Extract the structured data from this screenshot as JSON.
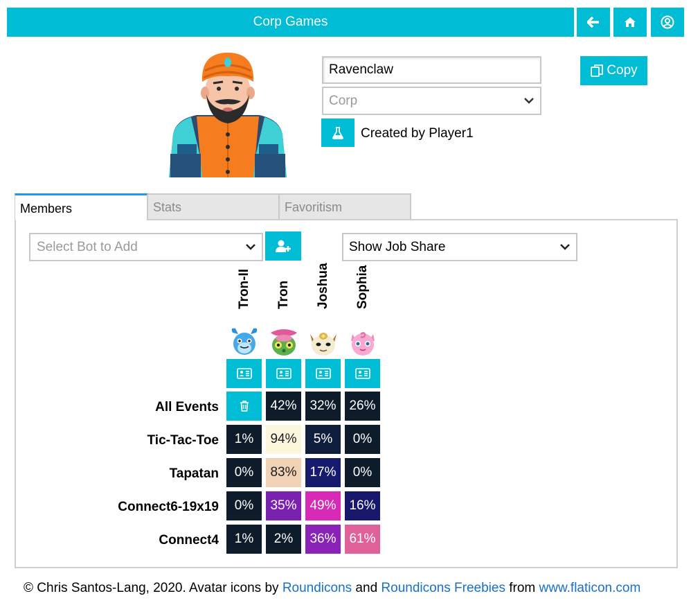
{
  "header": {
    "title": "Corp Games"
  },
  "nav": {
    "back_icon": "arrow-left-icon",
    "home_icon": "home-icon",
    "account_icon": "user-circle-icon"
  },
  "corp": {
    "name_value": "Ravenclaw",
    "type_value": "Corp",
    "created_by": "Created by Player1",
    "copy_label": "Copy",
    "avatar_icon": "turban-man-avatar"
  },
  "tabs": [
    {
      "label": "Members",
      "active": true
    },
    {
      "label": "Stats",
      "active": false
    },
    {
      "label": "Favoritism",
      "active": false
    }
  ],
  "members": {
    "bot_select_placeholder": "Select Bot to Add",
    "share_select_value": "Show Job Share",
    "bots": [
      {
        "name": "Tron-II",
        "avatar": "blue-monster-avatar"
      },
      {
        "name": "Tron",
        "avatar": "green-bug-avatar"
      },
      {
        "name": "Joshua",
        "avatar": "cat-avatar"
      },
      {
        "name": "Sophia",
        "avatar": "pink-puff-avatar"
      }
    ],
    "rows": [
      {
        "label": "All Events",
        "cells": [
          "",
          "42%",
          "32%",
          "26%"
        ],
        "colors": [
          "#00bcd4",
          "#0d1b2a",
          "#0d1b2a",
          "#0d1b2a"
        ]
      },
      {
        "label": "Tic-Tac-Toe",
        "cells": [
          "1%",
          "94%",
          "5%",
          "0%"
        ],
        "colors": [
          "#0d1b2a",
          "#fbf6dc",
          "#0f1e3c",
          "#0d1b2a"
        ]
      },
      {
        "label": "Tapatan",
        "cells": [
          "0%",
          "83%",
          "17%",
          "0%"
        ],
        "colors": [
          "#0d1b2a",
          "#f1d2b4",
          "#161b6e",
          "#0d1b2a"
        ]
      },
      {
        "label": "Connect6-19x19",
        "cells": [
          "0%",
          "35%",
          "49%",
          "16%"
        ],
        "colors": [
          "#0d1b2a",
          "#7a22b0",
          "#d82ab6",
          "#17186b"
        ]
      },
      {
        "label": "Connect4",
        "cells": [
          "1%",
          "2%",
          "36%",
          "61%"
        ],
        "colors": [
          "#0d1b2a",
          "#0d1b2a",
          "#8a22b8",
          "#e0609a"
        ]
      }
    ]
  },
  "footer": {
    "prefix": "© Chris Santos-Lang, 2020. Avatar icons by ",
    "link1": "Roundicons",
    "and": " and ",
    "link2": "Roundicons Freebies",
    "from": " from ",
    "link3": "www.flaticon.com"
  }
}
